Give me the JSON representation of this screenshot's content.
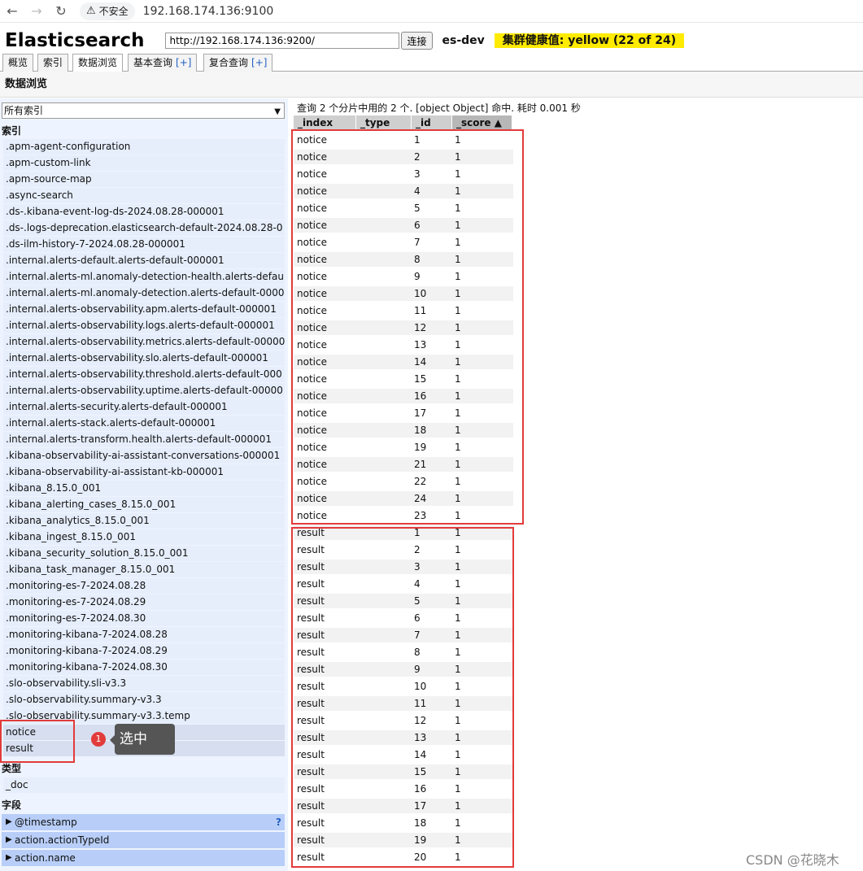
{
  "browser": {
    "security_label": "不安全",
    "url": "192.168.174.136:9100"
  },
  "header": {
    "logo": "Elasticsearch",
    "connect_url": "http://192.168.174.136:9200/",
    "connect_button": "连接",
    "cluster_name": "es-dev",
    "health": "集群健康值: yellow (22 of 24)",
    "health_color": "#ffeb00"
  },
  "tabs": [
    {
      "label": "概览",
      "plus": ""
    },
    {
      "label": "索引",
      "plus": ""
    },
    {
      "label": "数据浏览",
      "plus": ""
    },
    {
      "label": "基本查询",
      "plus": "[+]"
    },
    {
      "label": "复合查询",
      "plus": "[+]"
    }
  ],
  "section_title": "数据浏览",
  "sidebar": {
    "select_value": "所有索引",
    "indices_label": "索引",
    "indices": [
      ".apm-agent-configuration",
      ".apm-custom-link",
      ".apm-source-map",
      ".async-search",
      ".ds-.kibana-event-log-ds-2024.08.28-000001",
      ".ds-.logs-deprecation.elasticsearch-default-2024.08.28-0",
      ".ds-ilm-history-7-2024.08.28-000001",
      ".internal.alerts-default.alerts-default-000001",
      ".internal.alerts-ml.anomaly-detection-health.alerts-defau",
      ".internal.alerts-ml.anomaly-detection.alerts-default-0000",
      ".internal.alerts-observability.apm.alerts-default-000001",
      ".internal.alerts-observability.logs.alerts-default-000001",
      ".internal.alerts-observability.metrics.alerts-default-00000",
      ".internal.alerts-observability.slo.alerts-default-000001",
      ".internal.alerts-observability.threshold.alerts-default-000",
      ".internal.alerts-observability.uptime.alerts-default-00000",
      ".internal.alerts-security.alerts-default-000001",
      ".internal.alerts-stack.alerts-default-000001",
      ".internal.alerts-transform.health.alerts-default-000001",
      ".kibana-observability-ai-assistant-conversations-000001",
      ".kibana-observability-ai-assistant-kb-000001",
      ".kibana_8.15.0_001",
      ".kibana_alerting_cases_8.15.0_001",
      ".kibana_analytics_8.15.0_001",
      ".kibana_ingest_8.15.0_001",
      ".kibana_security_solution_8.15.0_001",
      ".kibana_task_manager_8.15.0_001",
      ".monitoring-es-7-2024.08.28",
      ".monitoring-es-7-2024.08.29",
      ".monitoring-es-7-2024.08.30",
      ".monitoring-kibana-7-2024.08.28",
      ".monitoring-kibana-7-2024.08.29",
      ".monitoring-kibana-7-2024.08.30",
      ".slo-observability.sli-v3.3",
      ".slo-observability.summary-v3.3",
      ".slo-observability.summary-v3.3.temp",
      "notice",
      "result"
    ],
    "types_label": "类型",
    "types": [
      "_doc"
    ],
    "fields_label": "字段",
    "fields": [
      "@timestamp",
      "action.actionTypeId",
      "action.name"
    ],
    "field_help": "?"
  },
  "annotation": {
    "badge": "1",
    "tooltip": "选中",
    "color": "#e23b3b"
  },
  "results": {
    "summary": "查询 2 个分片中用的 2 个. [object Object] 命中. 耗时 0.001 秒",
    "columns": [
      "_index",
      "_type",
      "_id",
      "_score ▲"
    ],
    "rows": [
      [
        "notice",
        "",
        "1",
        "1"
      ],
      [
        "notice",
        "",
        "2",
        "1"
      ],
      [
        "notice",
        "",
        "3",
        "1"
      ],
      [
        "notice",
        "",
        "4",
        "1"
      ],
      [
        "notice",
        "",
        "5",
        "1"
      ],
      [
        "notice",
        "",
        "6",
        "1"
      ],
      [
        "notice",
        "",
        "7",
        "1"
      ],
      [
        "notice",
        "",
        "8",
        "1"
      ],
      [
        "notice",
        "",
        "9",
        "1"
      ],
      [
        "notice",
        "",
        "10",
        "1"
      ],
      [
        "notice",
        "",
        "11",
        "1"
      ],
      [
        "notice",
        "",
        "12",
        "1"
      ],
      [
        "notice",
        "",
        "13",
        "1"
      ],
      [
        "notice",
        "",
        "14",
        "1"
      ],
      [
        "notice",
        "",
        "15",
        "1"
      ],
      [
        "notice",
        "",
        "16",
        "1"
      ],
      [
        "notice",
        "",
        "17",
        "1"
      ],
      [
        "notice",
        "",
        "18",
        "1"
      ],
      [
        "notice",
        "",
        "19",
        "1"
      ],
      [
        "notice",
        "",
        "21",
        "1"
      ],
      [
        "notice",
        "",
        "22",
        "1"
      ],
      [
        "notice",
        "",
        "24",
        "1"
      ],
      [
        "notice",
        "",
        "23",
        "1"
      ],
      [
        "result",
        "",
        "1",
        "1"
      ],
      [
        "result",
        "",
        "2",
        "1"
      ],
      [
        "result",
        "",
        "3",
        "1"
      ],
      [
        "result",
        "",
        "4",
        "1"
      ],
      [
        "result",
        "",
        "5",
        "1"
      ],
      [
        "result",
        "",
        "6",
        "1"
      ],
      [
        "result",
        "",
        "7",
        "1"
      ],
      [
        "result",
        "",
        "8",
        "1"
      ],
      [
        "result",
        "",
        "9",
        "1"
      ],
      [
        "result",
        "",
        "10",
        "1"
      ],
      [
        "result",
        "",
        "11",
        "1"
      ],
      [
        "result",
        "",
        "12",
        "1"
      ],
      [
        "result",
        "",
        "13",
        "1"
      ],
      [
        "result",
        "",
        "14",
        "1"
      ],
      [
        "result",
        "",
        "15",
        "1"
      ],
      [
        "result",
        "",
        "16",
        "1"
      ],
      [
        "result",
        "",
        "17",
        "1"
      ],
      [
        "result",
        "",
        "18",
        "1"
      ],
      [
        "result",
        "",
        "19",
        "1"
      ],
      [
        "result",
        "",
        "20",
        "1"
      ]
    ]
  },
  "watermark": "CSDN @花晓木"
}
